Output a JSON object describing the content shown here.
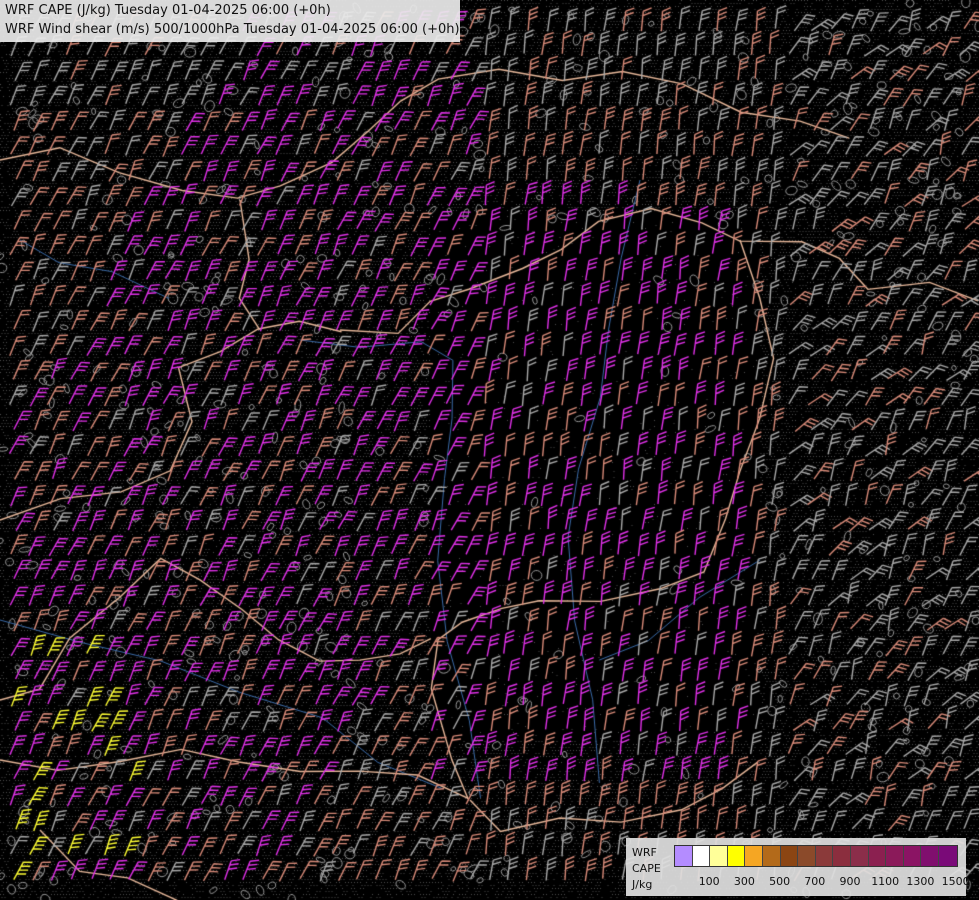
{
  "title": {
    "line1": "WRF CAPE (J/kg) Tuesday 01-04-2025 06:00 (+0h)",
    "line2": "WRF Wind shear (m/s) 500/1000hPa Tuesday 01-04-2025 06:00 (+0h)"
  },
  "legend": {
    "name_line1": "WRF",
    "name_line2": "CAPE",
    "name_line3": "J/kg",
    "tick_labels": [
      "100",
      "300",
      "500",
      "700",
      "900",
      "1100",
      "1300",
      "1500"
    ],
    "colors": [
      "#b48cff",
      "#ffffff",
      "#ffff99",
      "#ffff00",
      "#f5a623",
      "#b36a1a",
      "#8b4513",
      "#8b4a2a",
      "#8b3a3a",
      "#8b2e3e",
      "#8b2e4a",
      "#8b2050",
      "#8b1a5a",
      "#8b1464",
      "#800f6e",
      "#7a0a78"
    ]
  },
  "map": {
    "background": "#000000",
    "border_color": "#e8b89a",
    "river_color": "#3a6aa8",
    "contour_color": "#9a9a9a",
    "barb_colors": {
      "weak": "#a9a9a9",
      "moderate": "#d88a78",
      "strong": "#e030e8",
      "very_strong": "#ffff33"
    }
  }
}
